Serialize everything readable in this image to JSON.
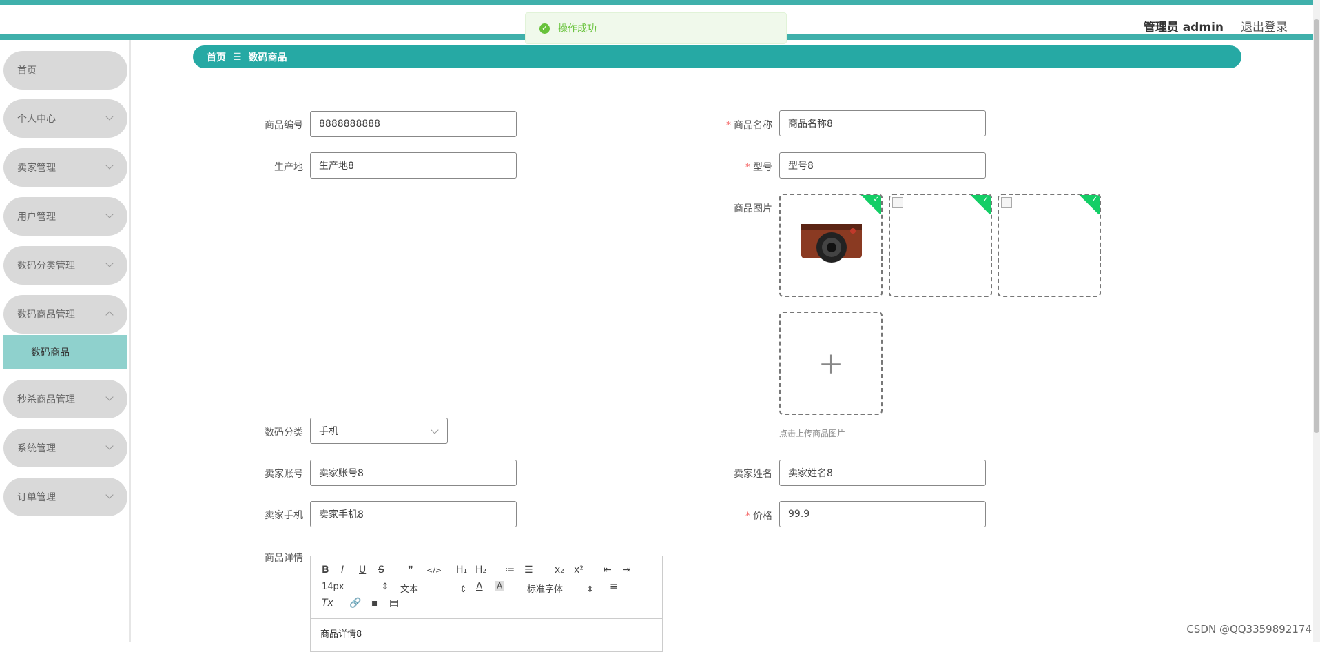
{
  "toast": {
    "message": "操作成功"
  },
  "header": {
    "user_label": "管理员 admin",
    "logout_label": "退出登录"
  },
  "sidebar": {
    "items": [
      {
        "label": "首页",
        "expandable": false
      },
      {
        "label": "个人中心",
        "expandable": true
      },
      {
        "label": "卖家管理",
        "expandable": true
      },
      {
        "label": "用户管理",
        "expandable": true
      },
      {
        "label": "数码分类管理",
        "expandable": true
      },
      {
        "label": "数码商品管理",
        "expandable": true,
        "expanded": true
      },
      {
        "label": "秒杀商品管理",
        "expandable": true
      },
      {
        "label": "系统管理",
        "expandable": true
      },
      {
        "label": "订单管理",
        "expandable": true
      }
    ],
    "active_sub_item": "数码商品"
  },
  "breadcrumb": {
    "home": "首页",
    "separator": "☰",
    "current": "数码商品"
  },
  "form": {
    "product_code": {
      "label": "商品编号",
      "value": "8888888888"
    },
    "product_name": {
      "label": "商品名称",
      "value": "商品名称8",
      "required": true
    },
    "origin": {
      "label": "生产地",
      "value": "生产地8"
    },
    "model": {
      "label": "型号",
      "value": "型号8",
      "required": true
    },
    "images": {
      "label": "商品图片",
      "hint": "点击上传商品图片",
      "upload_icon": "+"
    },
    "category": {
      "label": "数码分类",
      "value": "手机"
    },
    "seller_account": {
      "label": "卖家账号",
      "value": "卖家账号8"
    },
    "seller_name": {
      "label": "卖家姓名",
      "value": "卖家姓名8"
    },
    "seller_phone": {
      "label": "卖家手机",
      "value": "卖家手机8"
    },
    "price": {
      "label": "价格",
      "value": "99.9",
      "required": true
    },
    "details": {
      "label": "商品详情",
      "content": "商品详情8",
      "toolbar": {
        "bold": "B",
        "italic": "I",
        "underline": "U",
        "strike": "S",
        "blockquote": "❞",
        "code": "</>",
        "h1": "H₁",
        "h2": "H₂",
        "ordered": "≔",
        "bullet": "☰",
        "sub": "x₂",
        "sup": "x²",
        "outdent": "⇤",
        "indent": "⇥",
        "size": "14px",
        "header": "文本",
        "font": "标准字体",
        "clean": "Tx"
      }
    }
  },
  "watermark": "CSDN @QQ3359892174",
  "colors": {
    "accent": "#26a9a4",
    "toast_green": "#67c23a",
    "required": "#f56c6c"
  }
}
